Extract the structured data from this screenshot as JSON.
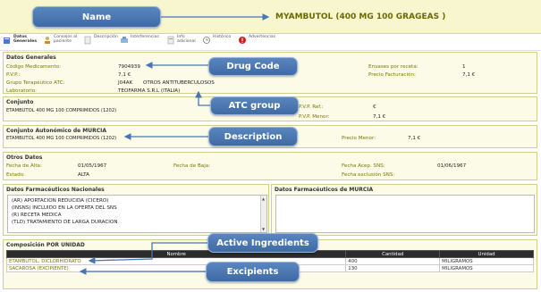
{
  "header": {
    "title": "MYAMBUTOL (400 MG 100 GRAGEAS )"
  },
  "toolbar": {
    "items": [
      {
        "label": "Datos Generales",
        "icon": "general-data-icon"
      },
      {
        "label": "Consejos al paciente",
        "icon": "patient-advice-icon"
      },
      {
        "label": "Descripción",
        "icon": "description-icon"
      },
      {
        "label": "Interferencias",
        "icon": "interference-icon"
      },
      {
        "label": "Info adicional",
        "icon": "info-icon"
      },
      {
        "label": "Histórico",
        "icon": "history-icon"
      },
      {
        "label": "Advertencias",
        "icon": "warning-icon"
      }
    ]
  },
  "general": {
    "title": "Datos Generales",
    "codigo_label": "Código Medicamento:",
    "codigo_value": "7904939",
    "pvp_label": "P.V.P.:",
    "pvp_value": "7,1 €",
    "atc_label": "Grupo Terapéutico ATC:",
    "atc_code": "J04AK",
    "atc_desc": "OTROS ANTITUBERCULOSOS",
    "lab_label": "Laboratorio:",
    "lab_value": "TEOFARMA S.R.L (ITALIA)",
    "envases_label": "Envases por receta:",
    "envases_value": "1",
    "precio_fact_label": "Precio Facturación:",
    "precio_fact_value": "7,1 €"
  },
  "conjunto": {
    "title": "Conjunto",
    "value": "ETAMBUTOL 400 MG 100 COMPRIMIDOS (1202)",
    "pvp_ref_label": "P.V.P. Ref.:",
    "pvp_ref_value": "€",
    "pvp_menor_label": "P.V.P. Menor:",
    "pvp_menor_value": "7,1 €"
  },
  "murcia": {
    "title": "Conjunto Autonómico de MURCIA",
    "value": "ETAMBUTOL 400 MG 100 COMPRIMIDOS (1202)",
    "precio_menor_label": "Precio Menor:",
    "precio_menor_value": "7,1 €"
  },
  "otros": {
    "title": "Otros Datos",
    "alta_label": "Fecha de Alta:",
    "alta_value": "01/05/1967",
    "baja_label": "Fecha de Baja:",
    "estado_label": "Estado:",
    "estado_value": "ALTA",
    "acep_label": "Fecha Acep. SNS:",
    "acep_value": "01/06/1967",
    "excl_label": "Fecha exclusión SNS:"
  },
  "farma_nac": {
    "title": "Datos Farmacéuticos Nacionales",
    "lines": [
      "(AR) APORTACION REDUCIDA (CICERO)",
      "(INSNS) INCLUIDO EN LA OFERTA DEL SNS",
      "(R) RECETA MEDICA",
      "(TLD) TRATAMIENTO DE LARGA DURACION"
    ]
  },
  "farma_murcia": {
    "title": "Datos Farmacéuticos de MURCIA"
  },
  "composicion": {
    "title": "Composición POR UNIDAD",
    "headers": [
      "Nombre",
      "Cantidad",
      "Unidad"
    ],
    "rows": [
      {
        "nombre": "ETAMBUTOL, DICLORHIDRATO",
        "cantidad": "400",
        "unidad": "MILIGRAMOS"
      },
      {
        "nombre": "SACAROSA (EXCIPIENTE)",
        "cantidad": "130",
        "unidad": "MILIGRAMOS"
      }
    ]
  },
  "callouts": {
    "name": "Name",
    "drug_code": "Drug Code",
    "atc": "ATC group",
    "description": "Description",
    "active": "Active Ingredients",
    "excipients": "Excipients"
  },
  "colors": {
    "callout": "#4a76b2",
    "label": "#7a7600",
    "panel_border": "#cfcf8a",
    "header_bg": "#f7f6cf"
  }
}
